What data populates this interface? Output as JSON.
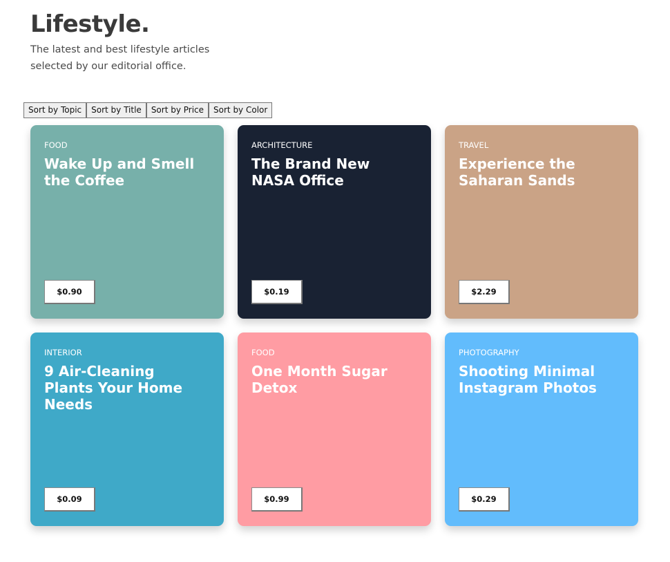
{
  "header": {
    "title": "Lifestyle.",
    "subtitle": "The latest and best lifestyle articles selected by our editorial office."
  },
  "sort": {
    "topic_label": "Sort by Topic",
    "title_label": "Sort by Title",
    "price_label": "Sort by Price",
    "color_label": "Sort by Color"
  },
  "cards": [
    {
      "topic": "Food",
      "title": "Wake Up and Smell the Coffee",
      "price": "$0.90",
      "color": "#77b0aa"
    },
    {
      "topic": "Architecture",
      "title": "The Brand New NASA Office",
      "price": "$0.19",
      "color": "#192233"
    },
    {
      "topic": "Travel",
      "title": "Experience the Saharan Sands",
      "price": "$2.29",
      "color": "#caa386"
    },
    {
      "topic": "Interior",
      "title": "9 Air-Cleaning Plants Your Home Needs",
      "price": "$0.09",
      "color": "#3fa9c8"
    },
    {
      "topic": "Food",
      "title": "One Month Sugar Detox",
      "price": "$0.99",
      "color": "#ff9ca3"
    },
    {
      "topic": "Photography",
      "title": "Shooting Minimal Instagram Photos",
      "price": "$0.29",
      "color": "#62bcfc"
    }
  ]
}
